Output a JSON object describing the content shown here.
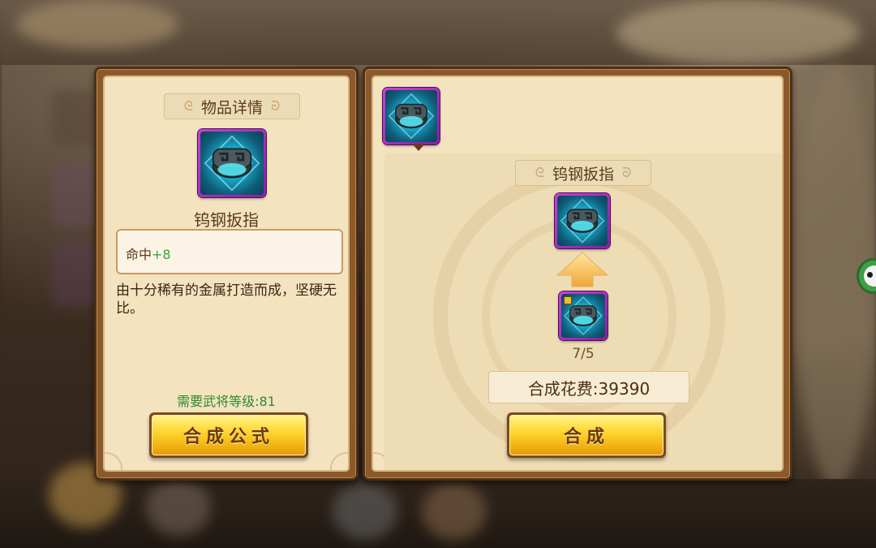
{
  "detail_panel": {
    "title": "物品详情",
    "item_name": "钨钢扳指",
    "item_icon": "tungsten-ring-icon",
    "attribute": {
      "name": "命中",
      "value": "+8"
    },
    "description": "由十分稀有的金属打造而成，坚硬无比。",
    "requirement": "需要武将等级:81",
    "formula_button": "合成公式"
  },
  "synthesis_panel": {
    "selected_icon": "tungsten-ring-icon",
    "target_title": "钨钢扳指",
    "target_icon": "tungsten-ring-icon",
    "arrow_icon": "up-arrow-icon",
    "material_icon": "tungsten-ring-fragment-icon",
    "material_count": "7/5",
    "cost": "合成花费:39390",
    "synthesize_button": "合成"
  },
  "colors": {
    "rarity_purple": "#b43cc8",
    "gem_cyan": "#38d8f5",
    "button_gold": "#ffd734",
    "attr_green": "#37a63a",
    "req_green": "#2f8a2f"
  }
}
